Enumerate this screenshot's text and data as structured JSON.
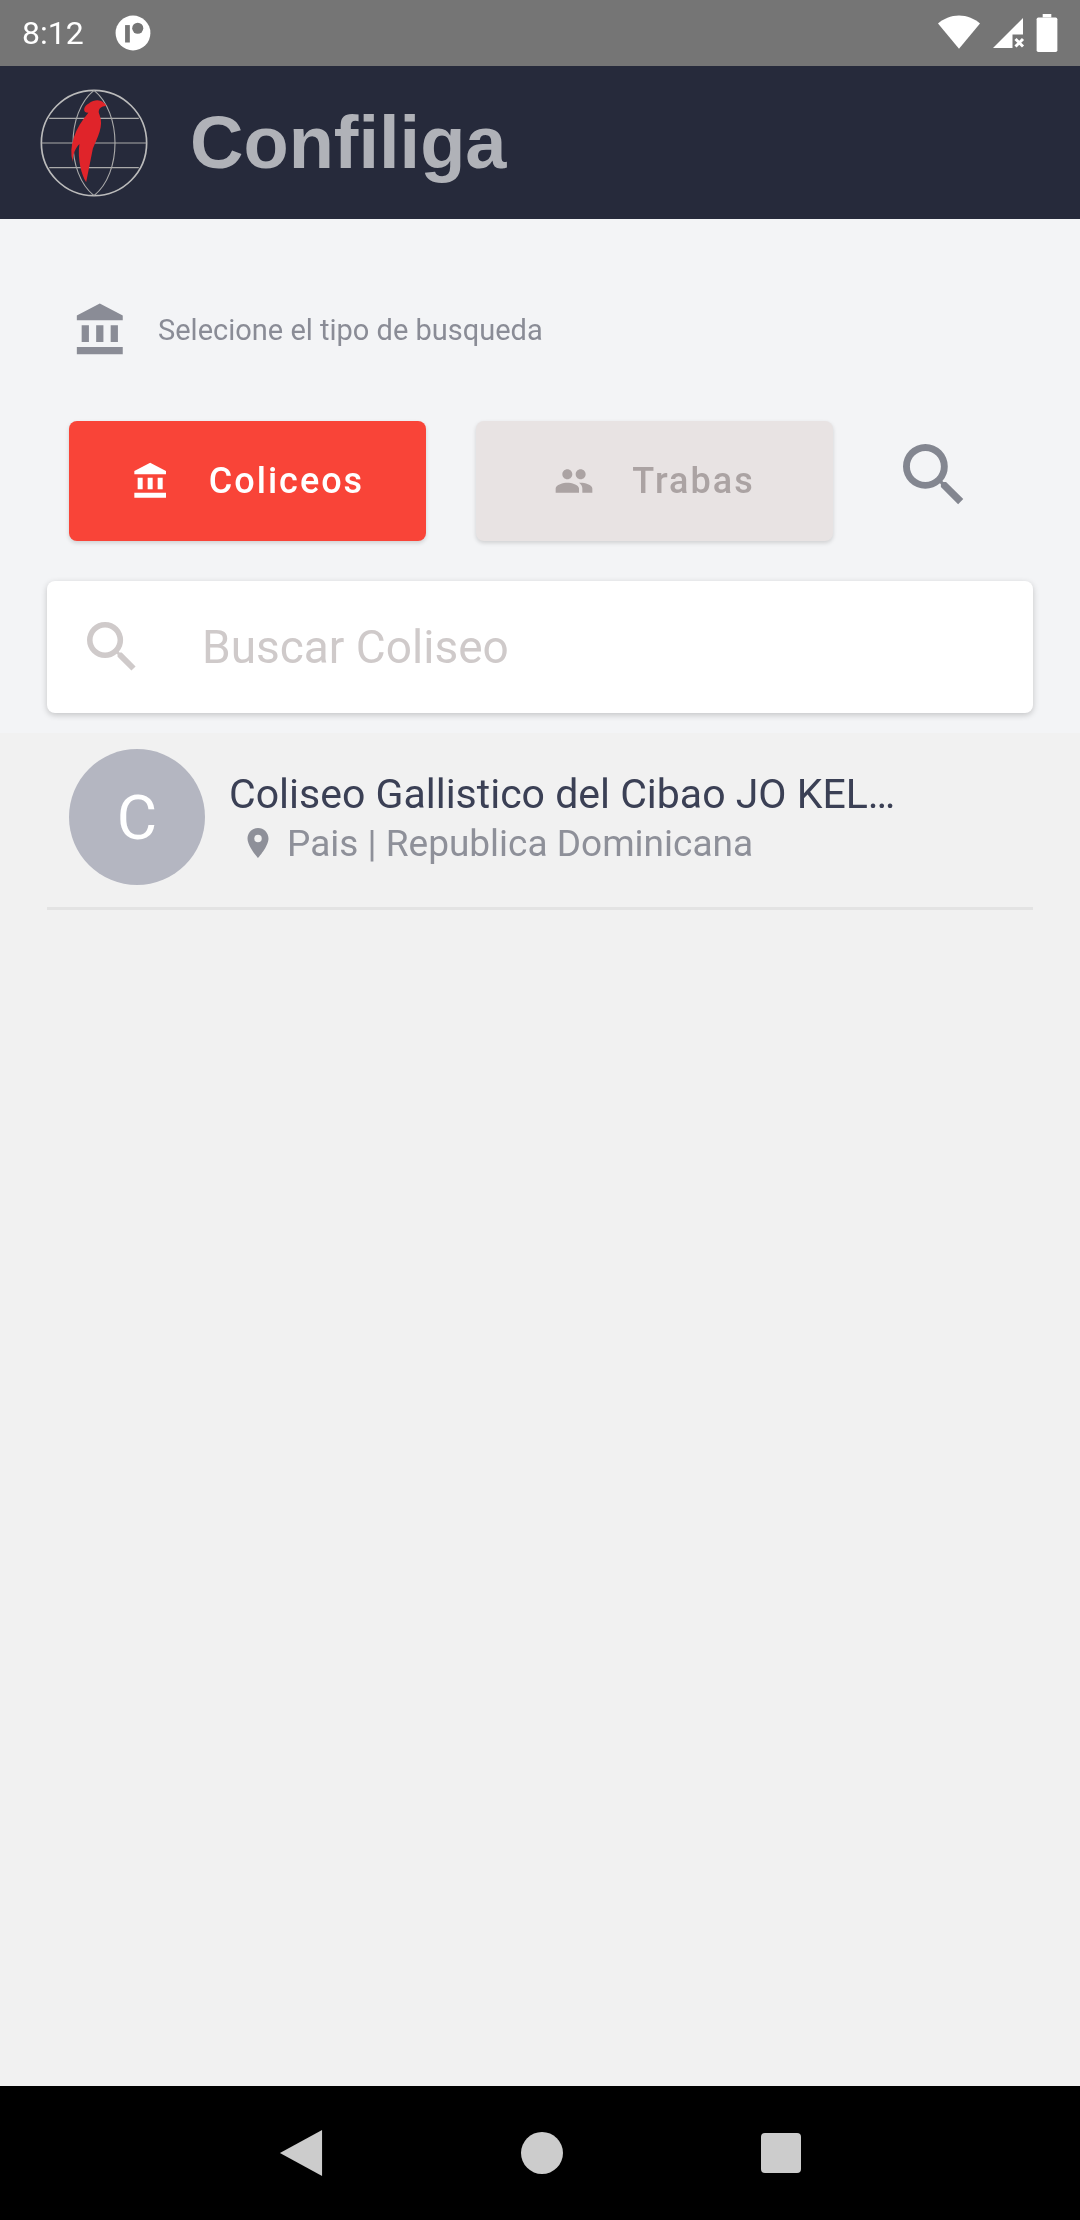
{
  "status_bar": {
    "time": "8:12"
  },
  "app_bar": {
    "title": "Confiliga"
  },
  "search_type": {
    "hint": "Selecione el tipo de busqueda"
  },
  "tabs": [
    {
      "label": "Coliceos",
      "selected": true
    },
    {
      "label": "Trabas",
      "selected": false
    }
  ],
  "search": {
    "placeholder": "Buscar Coliseo"
  },
  "results": [
    {
      "initial": "C",
      "title": "Coliseo Gallistico del Cibao JO KEL…",
      "subtitle": "Pais | Republica Dominicana"
    }
  ]
}
